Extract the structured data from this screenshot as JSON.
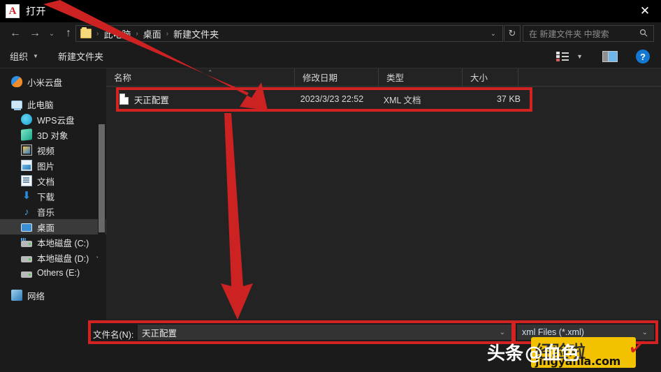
{
  "window": {
    "title": "打开",
    "app_icon": "autocad-a-icon",
    "logo_letter": "A",
    "close_label": "✕"
  },
  "navigation": {
    "back_icon": "←",
    "forward_icon": "→",
    "history_icon": "⌄",
    "up_icon": "↑",
    "refresh_icon": "↻",
    "folder_icon": "folder-icon",
    "breadcrumbs": [
      "此电脑",
      "桌面",
      "新建文件夹"
    ],
    "separator": "›",
    "address_chevron": "⌄"
  },
  "search": {
    "placeholder": "在 新建文件夹 中搜索",
    "icon": "🔍"
  },
  "toolbar": {
    "organize_label": "组织",
    "organize_caret": "▼",
    "new_folder_label": "新建文件夹",
    "view_icon": "view-list-icon",
    "view_caret": "▼",
    "preview_pane_icon": "preview-pane-icon",
    "help_label": "?"
  },
  "sidebar": {
    "items": [
      {
        "label": "小米云盘",
        "icon": "mi-cloud-icon",
        "indent": false,
        "selected": false
      },
      {
        "label": "此电脑",
        "icon": "this-pc-icon",
        "indent": false,
        "selected": false
      },
      {
        "label": "WPS云盘",
        "icon": "wps-cloud-icon",
        "indent": true,
        "selected": false
      },
      {
        "label": "3D 对象",
        "icon": "3d-objects-icon",
        "indent": true,
        "selected": false
      },
      {
        "label": "视频",
        "icon": "videos-icon",
        "indent": true,
        "selected": false
      },
      {
        "label": "图片",
        "icon": "pictures-icon",
        "indent": true,
        "selected": false
      },
      {
        "label": "文档",
        "icon": "documents-icon",
        "indent": true,
        "selected": false
      },
      {
        "label": "下载",
        "icon": "downloads-icon",
        "indent": true,
        "selected": false
      },
      {
        "label": "音乐",
        "icon": "music-icon",
        "indent": true,
        "selected": false
      },
      {
        "label": "桌面",
        "icon": "desktop-icon",
        "indent": true,
        "selected": true
      },
      {
        "label": "本地磁盘 (C:)",
        "icon": "system-drive-icon",
        "indent": true,
        "selected": false
      },
      {
        "label": "本地磁盘 (D:)",
        "icon": "drive-icon",
        "indent": true,
        "selected": false
      },
      {
        "label": "Others (E:)",
        "icon": "drive-icon",
        "indent": true,
        "selected": false
      },
      {
        "label": "网络",
        "icon": "network-icon",
        "indent": false,
        "selected": false
      }
    ],
    "scroll_chevron": "⌄"
  },
  "filelist": {
    "columns": [
      "名称",
      "修改日期",
      "类型",
      "大小"
    ],
    "sort_indicator": "⌃",
    "rows": [
      {
        "name": "天正配置",
        "modified": "2023/3/23 22:52",
        "type": "XML 文档",
        "size": "37 KB",
        "icon": "xml-file-icon"
      }
    ]
  },
  "bottom": {
    "filename_label": "文件名(N):",
    "filename_value": "天正配置",
    "filename_chevron": "⌄",
    "filetype_value": "xml Files (*.xml)",
    "filetype_chevron": "⌄"
  },
  "annotations": {
    "highlight_color": "#d32222",
    "arrow_color": "#cc2222",
    "arrows": [
      {
        "name": "arrow-to-file-row",
        "from": "title-area",
        "to": "file-row"
      },
      {
        "name": "arrow-to-filename-field",
        "from": "file-row",
        "to": "filename-field"
      }
    ]
  },
  "watermark": {
    "toutiao_text": "头条",
    "at_text": "@血色",
    "jingyanla_cn": "经验啦",
    "jingyanla_en": "jingyanla.com",
    "check_mark": "✓",
    "brand_color": "#f2c200"
  }
}
